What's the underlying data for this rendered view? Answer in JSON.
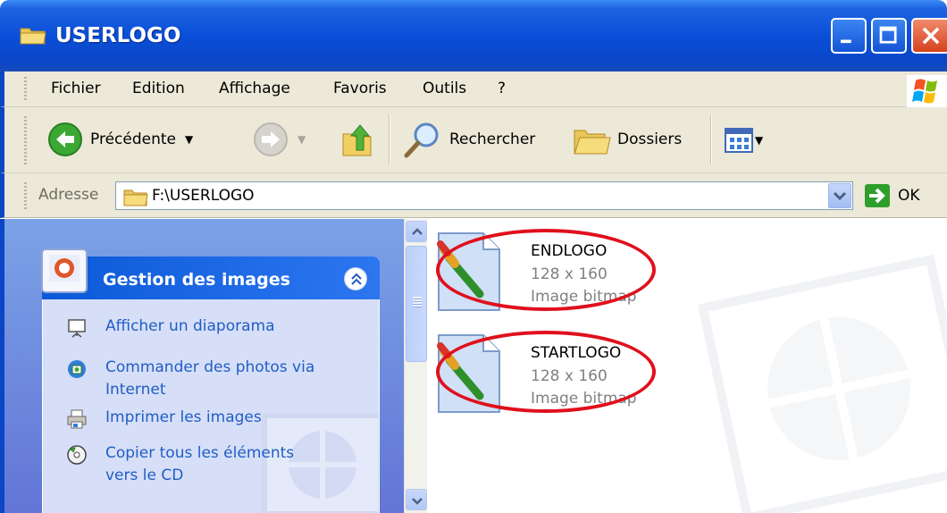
{
  "window": {
    "title": "USERLOGO",
    "controls": [
      "minimize",
      "maximize",
      "close"
    ]
  },
  "menu": {
    "items": [
      "Fichier",
      "Edition",
      "Affichage",
      "Favoris",
      "Outils",
      "?"
    ]
  },
  "toolbar": {
    "back_label": "Précédente",
    "search_label": "Rechercher",
    "folders_label": "Dossiers"
  },
  "address": {
    "label": "Adresse",
    "value": "F:\\USERLOGO",
    "go_label": "OK"
  },
  "task_pane": {
    "title": "Gestion des images",
    "tasks": [
      {
        "label": "Afficher un diaporama",
        "icon": "slideshow-icon"
      },
      {
        "label": "Commander des photos via Internet",
        "icon": "order-photos-icon"
      },
      {
        "label": "Imprimer les images",
        "icon": "printer-icon"
      },
      {
        "label": "Copier tous les éléments vers le CD",
        "icon": "cd-copy-icon"
      }
    ]
  },
  "files": [
    {
      "name": "ENDLOGO",
      "dimensions": "128 x 160",
      "type": "Image bitmap",
      "highlighted": true
    },
    {
      "name": "STARTLOGO",
      "dimensions": "128 x 160",
      "type": "Image bitmap",
      "highlighted": true
    }
  ],
  "colors": {
    "titlebar": "#0a46c6",
    "chrome": "#ece9d8",
    "link": "#215dc6",
    "annotation": "#e0101c"
  }
}
